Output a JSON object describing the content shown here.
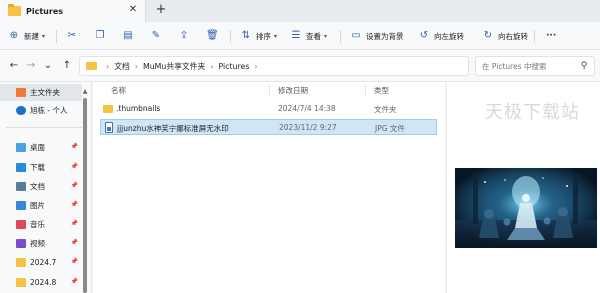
{
  "tab": {
    "title": "Pictures",
    "close": "✕",
    "new_tab": "+"
  },
  "toolbar": {
    "new_label": "新建",
    "sort_label": "排序",
    "view_label": "查看",
    "set_background_label": "设置为背景",
    "rotate_left_label": "向左旋转",
    "rotate_right_label": "向右旋转",
    "more": "···"
  },
  "nav": {
    "back": "←",
    "forward": "→",
    "recent": "⌄",
    "up": "↑"
  },
  "address": {
    "crumbs": [
      "文档",
      "MuMu共享文件夹",
      "Pictures"
    ],
    "separator": "›",
    "dropdown": "⌄"
  },
  "search": {
    "placeholder": "在 Pictures 中搜索"
  },
  "sidebar": {
    "items": [
      {
        "label": "主文件夹",
        "icon": "home-icon",
        "color": "#f07a3a"
      },
      {
        "label": "旭栋 - 个人",
        "icon": "cloud-icon",
        "color": "#1d70c8"
      },
      {
        "label": "桌面",
        "icon": "desktop-icon",
        "color": "#4aa3df",
        "pinned": true
      },
      {
        "label": "下载",
        "icon": "download-icon",
        "color": "#2a8ad6",
        "pinned": true
      },
      {
        "label": "文档",
        "icon": "document-icon",
        "color": "#5b7c99",
        "pinned": true
      },
      {
        "label": "图片",
        "icon": "image-icon",
        "color": "#3a87d9",
        "pinned": true
      },
      {
        "label": "音乐",
        "icon": "music-icon",
        "color": "#e0495c",
        "pinned": true
      },
      {
        "label": "视频",
        "icon": "video-icon",
        "color": "#7b4bd0",
        "pinned": true
      },
      {
        "label": "2024.7",
        "icon": "folder-icon",
        "color": "#f5c242",
        "pinned": true
      },
      {
        "label": "2024.8",
        "icon": "folder-icon",
        "color": "#f5c242",
        "pinned": true
      }
    ],
    "pin_glyph": "📌"
  },
  "table": {
    "headers": [
      "名称",
      "修改日期",
      "类型"
    ],
    "rows": [
      {
        "name": ".thumbnails",
        "date": "2024/7/4 14:38",
        "type": "文件夹",
        "kind": "folder"
      },
      {
        "name": "jjjunzhu水神芙宁娜标准屏无水印",
        "date": "2023/11/2 9:27",
        "type": "JPG 文件",
        "kind": "file",
        "selected": true
      }
    ]
  },
  "preview": {
    "watermark": "天极下载站"
  },
  "colors": {
    "accent": "#305fa8",
    "selection": "#cfe6f7",
    "folder": "#f5c242"
  }
}
